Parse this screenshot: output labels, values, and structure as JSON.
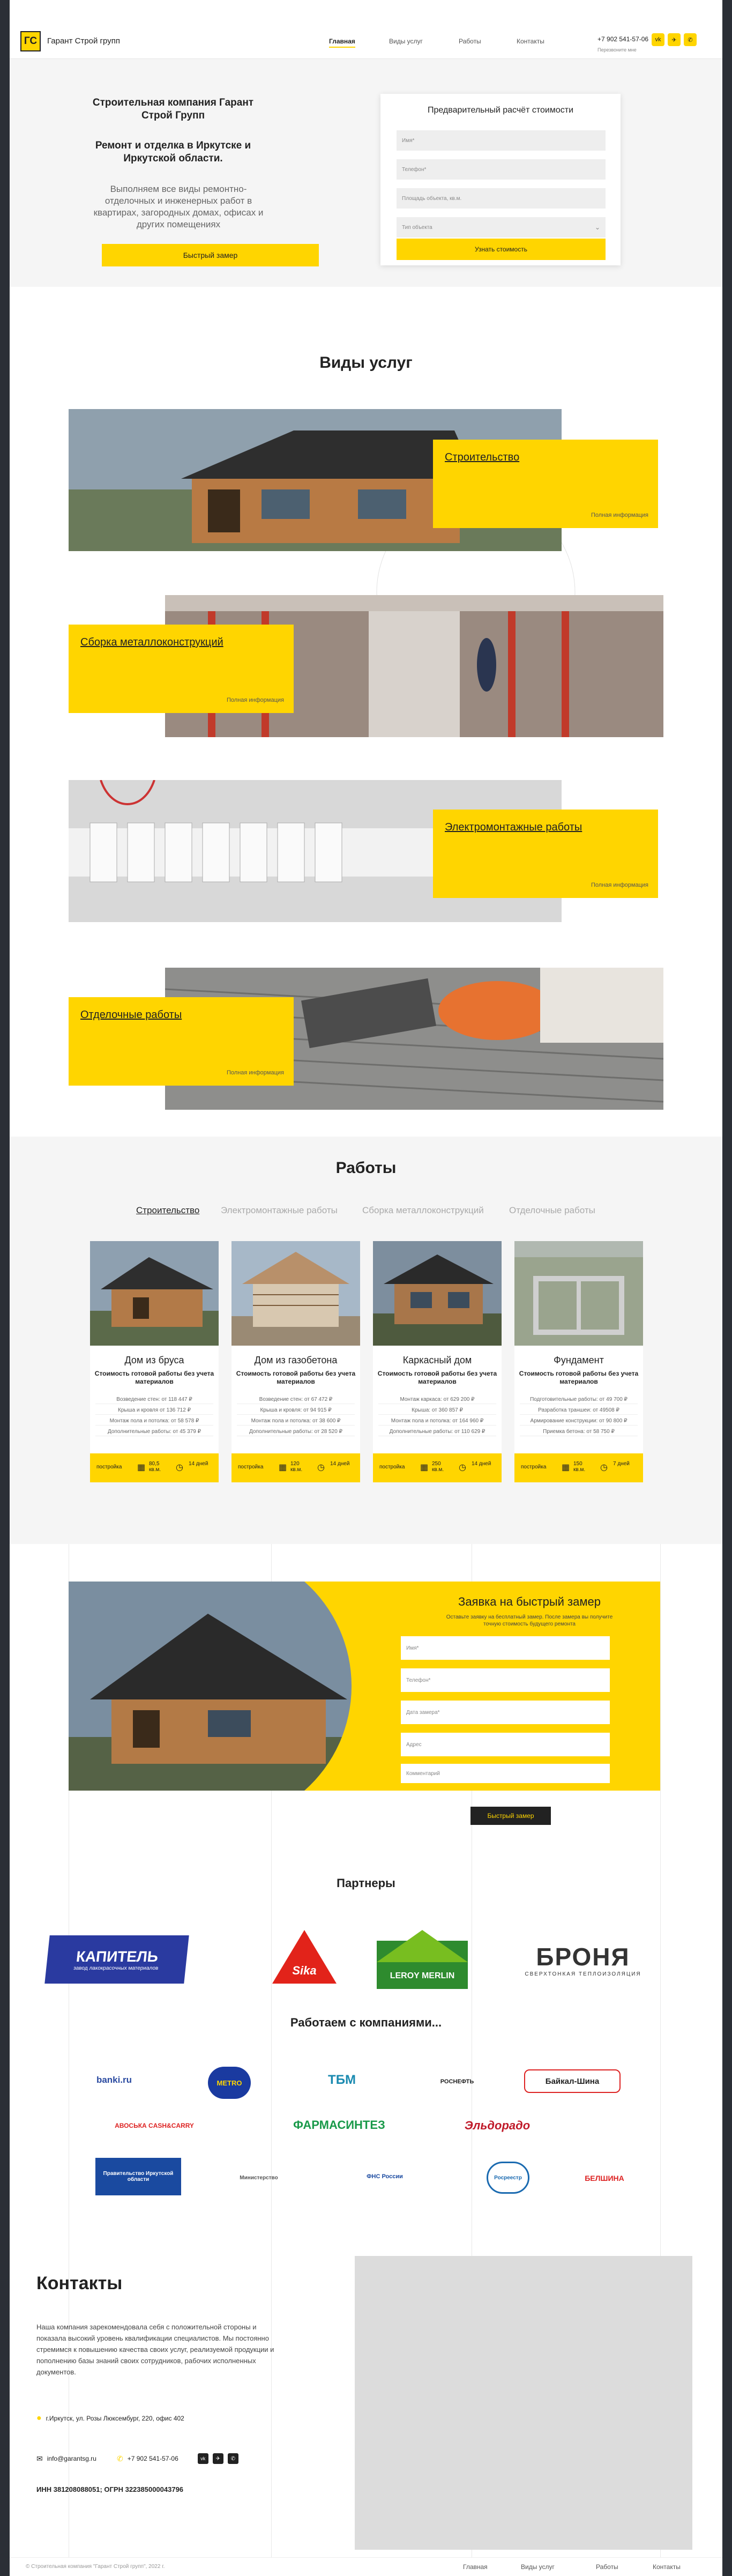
{
  "header": {
    "logo": "ГС",
    "company": "Гарант Строй групп",
    "nav": [
      "Главная",
      "Виды услуг",
      "Работы",
      "Контакты"
    ],
    "phone": "+7 902 541-57-06",
    "callme": "Перезвоните мне"
  },
  "hero": {
    "title": "Строительная компания Гарант Строй Групп",
    "subtitle": "Ремонт и отделка в Иркутске и Иркутской области.",
    "desc": "Выполняем все виды ремонтно-отделочных и инженерных работ в квартирах, загородных домах, офисах и других помещениях",
    "button": "Быстрый замер",
    "form": {
      "title": "Предварительный расчёт стоимости",
      "name": "Имя*",
      "phone": "Телефон*",
      "area": "Площадь объекта, кв.м.",
      "type": "Тип объекта",
      "submit": "Узнать стоимость"
    }
  },
  "services": {
    "title": "Виды услуг",
    "more": "Полная информация",
    "items": [
      "Строительство",
      "Сборка металлоконструкций",
      "Электромонтажные работы",
      "Отделочные работы"
    ]
  },
  "works": {
    "title": "Работы",
    "tabs": [
      "Строительство",
      "Электромонтажные работы",
      "Сборка металлоконструкций",
      "Отделочные работы"
    ],
    "subtitle": "Стоимость готовой работы без учета материалов",
    "cards": [
      {
        "name": "Дом из бруса",
        "lines": [
          "Возведение стен: от 118 447 ₽",
          "Крыша и кровля от 136 712 ₽",
          "Монтаж пола и потолка: от 58 578 ₽",
          "Дополнительные работы: от 45 379 ₽"
        ],
        "area": "80,5 кв.м.",
        "days": "14 дней"
      },
      {
        "name": "Дом из газобетона",
        "lines": [
          "Возведение стен: от 67 472 ₽",
          "Крыша и кровля: от 94 915 ₽",
          "Монтаж пола и потолка: от 38 600 ₽",
          "Дополнительные работы: от 28 520 ₽"
        ],
        "area": "120 кв.м.",
        "days": "14 дней"
      },
      {
        "name": "Каркасный дом",
        "lines": [
          "Монтаж каркаса: от 629 200 ₽",
          "Крыша: от 360 857 ₽",
          "Монтаж пола и потолка: от 164 960 ₽",
          "Дополнительные работы: от 110 629 ₽"
        ],
        "area": "250 кв.м.",
        "days": "14 дней"
      },
      {
        "name": "Фундамент",
        "lines": [
          "Подготовительные работы: от 49 700 ₽",
          "Разработка траншеи: от 49508 ₽",
          "Армирование конструкции: от 90 800 ₽",
          "Приемка бетона: от 58 750 ₽"
        ],
        "area": "150 кв.м.",
        "days": "7 дней"
      }
    ],
    "foot_label": "постройка"
  },
  "order": {
    "title": "Заявка на быстрый замер",
    "sub": "Оставьте заявку на бесплатный замер. После замера вы получите точную стоимость будущего ремонта",
    "fields": [
      "Имя*",
      "Телефон*",
      "Дата замера*",
      "Адрес",
      "Комментарий"
    ],
    "submit": "Быстрый замер"
  },
  "partners": {
    "title": "Партнеры",
    "logos": [
      "КАПИТЕЛЬ",
      "Sika",
      "LEROY MERLIN",
      "БРОНЯ"
    ],
    "kapitel_sub": "завод лакокрасочных материалов",
    "bronya_sub": "СВЕРХТОНКАЯ ТЕПЛОИЗОЛЯЦИЯ"
  },
  "companies": {
    "title": "Работаем с компаниями...",
    "logos": [
      "banki.ru",
      "METRO",
      "ТБМ",
      "РОСНЕФТЬ",
      "Байкал-Шина",
      "АВОСЬКА CASH&CARRY",
      "ФАРМАСИНТЕЗ",
      "Эльдорадо",
      "Правительство Иркутской области",
      "Министерство",
      "ФНС России",
      "Росреестр",
      "БЕЛШИНА"
    ]
  },
  "contacts": {
    "title": "Контакты",
    "text": "Наша компания зарекомендовала себя с положительной стороны и показала высокий уровень квалификации специалистов. Мы постоянно стремимся к повышению качества своих услуг, реализуемой продукции и пополнению базы знаний своих сотрудников, рабочих исполненных документов.",
    "address": "г.Иркутск, ул. Розы Люксембург, 220, офис 402",
    "email": "info@garantsg.ru",
    "phone": "+7 902 541-57-06",
    "inn": "ИНН 381208088051; ОГРН 322385000043796"
  },
  "footer": {
    "copy": "© Строительная компания \"Гарант Строй групп\", 2022 г.",
    "links": [
      "Главная",
      "Виды услуг",
      "Работы",
      "Контакты"
    ]
  },
  "colors": {
    "accent": "#ffd500",
    "dark": "#222222",
    "light": "#f5f5f5"
  }
}
